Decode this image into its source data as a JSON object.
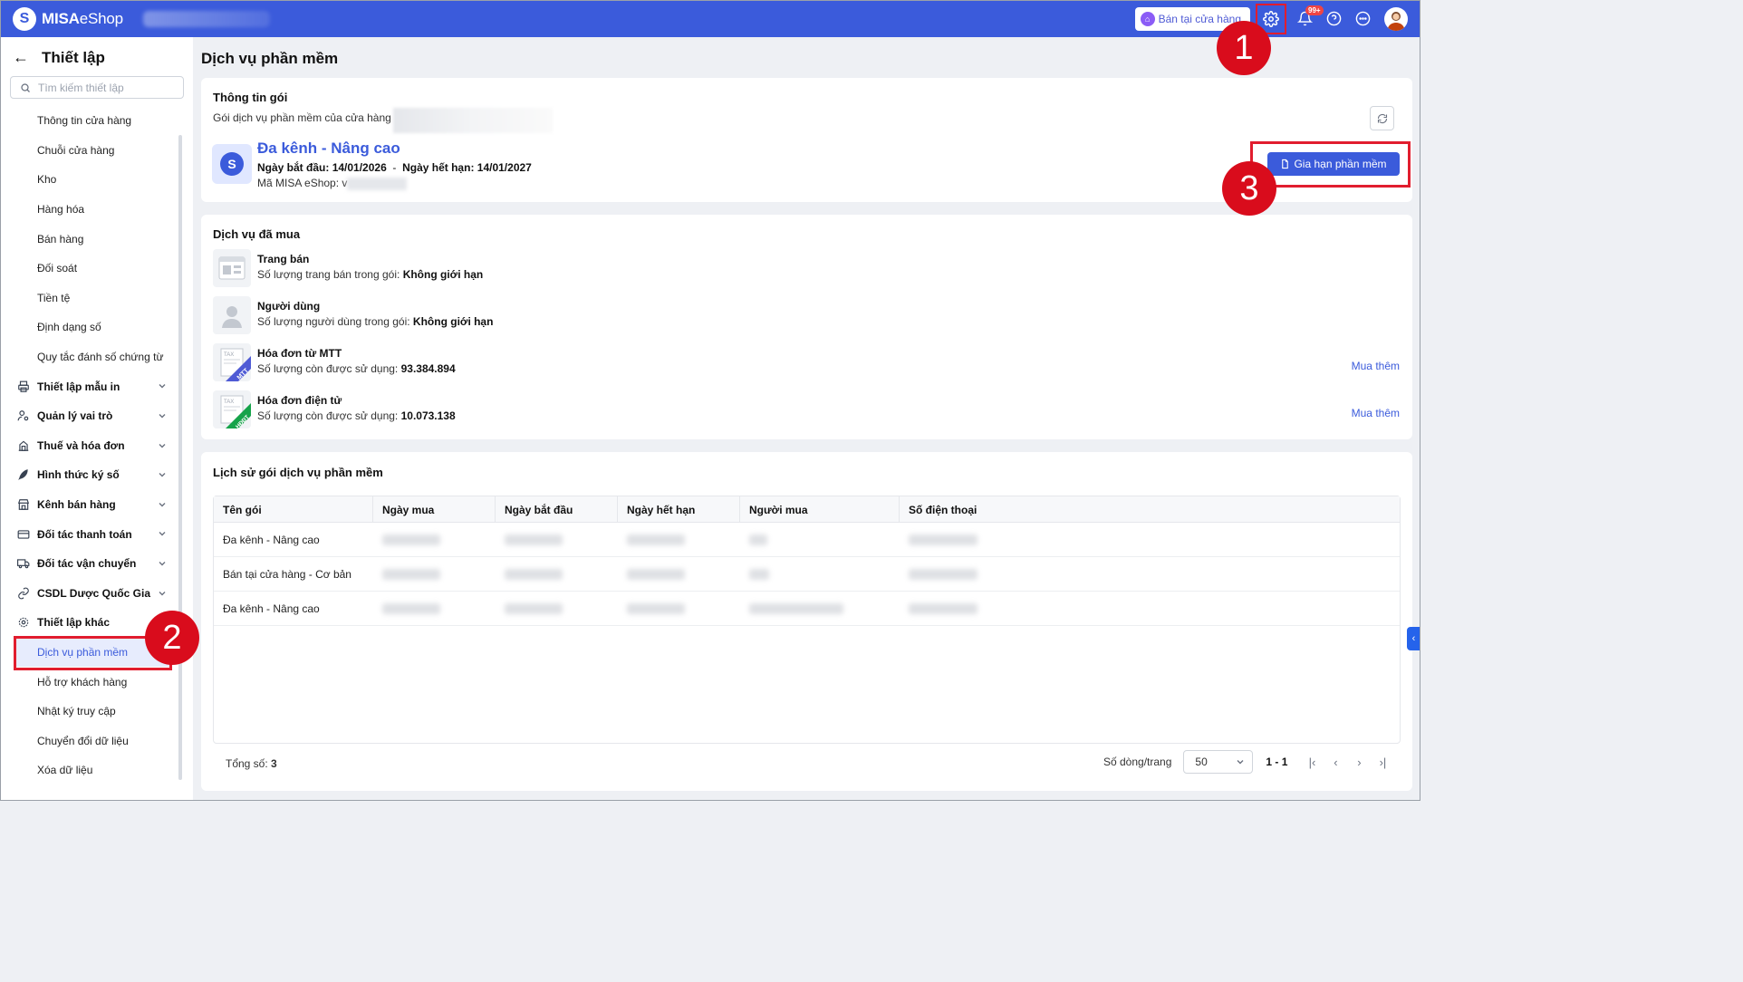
{
  "topbar": {
    "logo_bold": "MISA",
    "logo_rest": "eShop",
    "store_button": "Bán tại cửa hàng",
    "notification_badge": "99+",
    "icons": [
      "settings-icon",
      "bell-icon",
      "help-icon",
      "chat-icon",
      "avatar"
    ]
  },
  "sidebar": {
    "title": "Thiết lập",
    "search_placeholder": "Tìm kiếm thiết lập",
    "items": [
      {
        "label": "Thông tin cửa hàng"
      },
      {
        "label": "Chuỗi cửa hàng"
      },
      {
        "label": "Kho"
      },
      {
        "label": "Hàng hóa"
      },
      {
        "label": "Bán hàng"
      },
      {
        "label": "Đối soát"
      },
      {
        "label": "Tiền tệ"
      },
      {
        "label": "Định dạng số"
      },
      {
        "label": "Quy tắc đánh số chứng từ"
      }
    ],
    "groups": [
      {
        "label": "Thiết lập mẫu in",
        "icon": "printer-icon"
      },
      {
        "label": "Quản lý vai trò",
        "icon": "user-role-icon"
      },
      {
        "label": "Thuế và hóa đơn",
        "icon": "tax-icon"
      },
      {
        "label": "Hình thức ký số",
        "icon": "pen-icon"
      },
      {
        "label": "Kênh bán hàng",
        "icon": "store-icon"
      },
      {
        "label": "Đối tác thanh toán",
        "icon": "card-icon"
      },
      {
        "label": "Đối tác vận chuyển",
        "icon": "truck-icon"
      },
      {
        "label": "CSDL Dược Quốc Gia",
        "icon": "link-icon"
      },
      {
        "label": "Thiết lập khác",
        "icon": "gear-icon"
      }
    ],
    "sub_items": [
      {
        "label": "Dịch vụ phần mềm",
        "active": true
      },
      {
        "label": "Hỗ trợ khách hàng"
      },
      {
        "label": "Nhật ký truy cập"
      },
      {
        "label": "Chuyển đổi dữ liệu"
      },
      {
        "label": "Xóa dữ liệu"
      }
    ]
  },
  "main": {
    "page_title": "Dịch vụ phần mềm",
    "package": {
      "title": "Thông tin gói",
      "subtitle": "Gói dịch vụ phần mềm của cửa hàng",
      "name": "Đa kênh - Nâng cao",
      "start_label": "Ngày bắt đầu:",
      "start_date": "14/01/2026",
      "separator": "-",
      "end_label": "Ngày hết hạn:",
      "end_date": "14/01/2027",
      "code_label": "Mã MISA eShop:",
      "code_visible": "v",
      "renew_button": "Gia hạn phần mềm"
    },
    "services": {
      "title": "Dịch vụ đã mua",
      "items": [
        {
          "name": "Trang bán",
          "desc": "Số lượng trang bán trong gói:",
          "value": "Không giới hạn",
          "buy_more": ""
        },
        {
          "name": "Người dùng",
          "desc": "Số lượng người dùng trong gói:",
          "value": "Không giới hạn",
          "buy_more": ""
        },
        {
          "name": "Hóa đơn từ MTT",
          "desc": "Số lượng còn được sử dụng:",
          "value": "93.384.894",
          "buy_more": "Mua thêm"
        },
        {
          "name": "Hóa đơn điện tử",
          "desc": "Số lượng còn được sử dụng:",
          "value": "10.073.138",
          "buy_more": "Mua thêm"
        }
      ],
      "icon_labels": {
        "tax": "TAX",
        "mtt": "MTT",
        "hddt": "HĐĐT"
      }
    },
    "history": {
      "title": "Lịch sử gói dịch vụ phần mềm",
      "columns": [
        "Tên gói",
        "Ngày mua",
        "Ngày bắt đầu",
        "Ngày hết hạn",
        "Người mua",
        "Số điện thoại"
      ],
      "rows": [
        {
          "name": "Đa kênh - Nâng cao"
        },
        {
          "name": "Bán tại cửa hàng - Cơ bản"
        },
        {
          "name": "Đa kênh - Nâng cao"
        }
      ],
      "total_label": "Tổng số:",
      "total_value": "3",
      "page_size_label": "Số dòng/trang",
      "page_size": "50",
      "page_range": "1 - 1"
    }
  },
  "callouts": [
    "1",
    "2",
    "3"
  ],
  "colors": {
    "primary": "#3b5bdb",
    "callout": "#d90c1c",
    "topbar": "#3b5bdb"
  }
}
